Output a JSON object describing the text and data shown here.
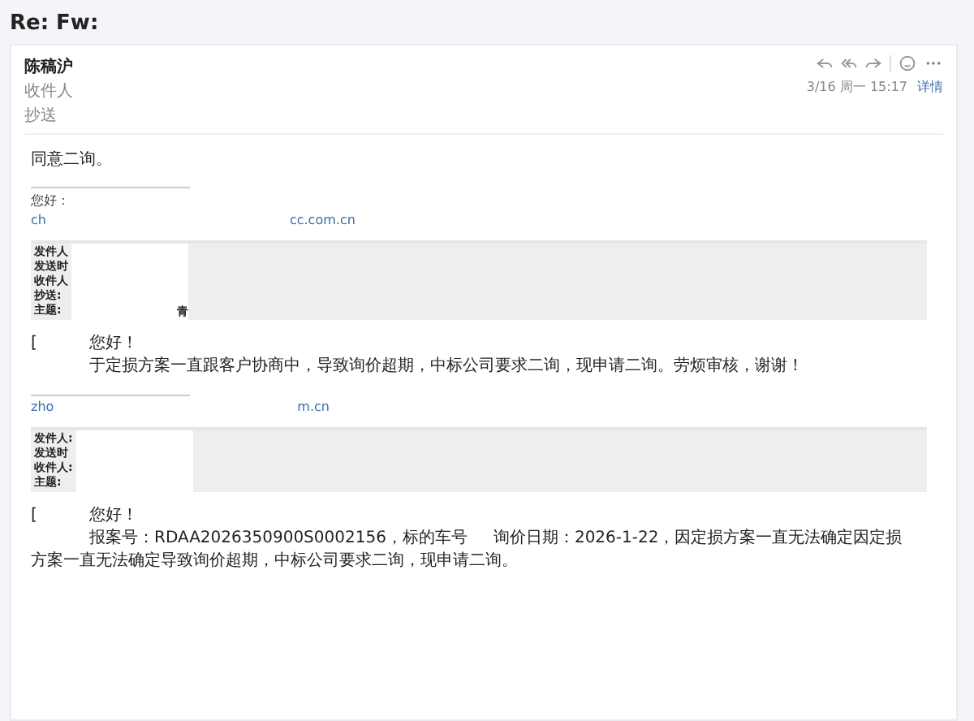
{
  "title": "Re: Fw:",
  "header": {
    "sender": "陈稿沪",
    "to_label": "收件人",
    "cc_label": "抄送",
    "date": "3/16 周一 15:17",
    "details_link": "详情",
    "actions": [
      {
        "kind": "reply"
      },
      {
        "kind": "reply_all"
      },
      {
        "kind": "forward"
      },
      {
        "kind": "separator"
      },
      {
        "kind": "emoji"
      },
      {
        "kind": "more"
      }
    ]
  },
  "body": [
    {
      "kind": "text",
      "text": "同意二询。"
    },
    {
      "kind": "signature",
      "greeting": "您好：",
      "link_start": "ch",
      "link_end": "cc.com.cn"
    },
    {
      "kind": "quote",
      "labels": [
        "发件人",
        "发送时",
        "收件人",
        "抄送:",
        "主题:"
      ],
      "subject_tail": "青"
    },
    {
      "kind": "message",
      "lead": "[",
      "greeting": "您好！",
      "lines": [
        {
          "indent": true,
          "text": "于定损方案一直跟客户协商中，导致询价超期，中标公司要求二询，现申请二询。劳烦审核，谢谢！"
        }
      ]
    },
    {
      "kind": "signature",
      "link_start": "zho",
      "link_end": "m.cn"
    },
    {
      "kind": "quote",
      "labels": [
        "发件人:",
        "发送时",
        "收件人:",
        "主题:"
      ]
    },
    {
      "kind": "message",
      "lead": "[",
      "greeting": "您好！",
      "lines": [
        {
          "indent": true,
          "text": "报案号：RDAA2026350900S0002156，标的车号",
          "tail": "询价日期：2026-1-22，因定损方案一直无法确定因定损"
        },
        {
          "indent": false,
          "text": "方案一直无法确定导致询价超期，中标公司要求二询，现申请二询。"
        }
      ]
    }
  ]
}
